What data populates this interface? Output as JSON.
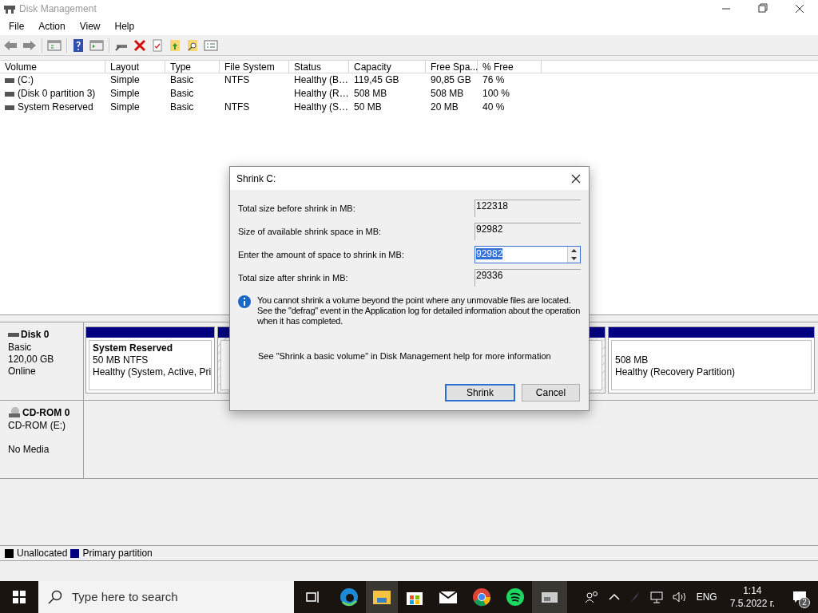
{
  "window": {
    "title": "Disk Management"
  },
  "menu": [
    "File",
    "Action",
    "View",
    "Help"
  ],
  "table": {
    "columns": [
      "Volume",
      "Layout",
      "Type",
      "File System",
      "Status",
      "Capacity",
      "Free Spa...",
      "% Free"
    ],
    "rows": [
      {
        "cells": [
          "(C:)",
          "Simple",
          "Basic",
          "NTFS",
          "Healthy (B…",
          "119,45 GB",
          "90,85 GB",
          "76 %"
        ]
      },
      {
        "cells": [
          "(Disk 0 partition 3)",
          "Simple",
          "Basic",
          "",
          "Healthy (R…",
          "508 MB",
          "508 MB",
          "100 %"
        ]
      },
      {
        "cells": [
          "System Reserved",
          "Simple",
          "Basic",
          "NTFS",
          "Healthy (S…",
          "50 MB",
          "20 MB",
          "40 %"
        ]
      }
    ]
  },
  "disks": [
    {
      "kind": "disk",
      "name": "Disk 0",
      "lines": [
        "Basic",
        "120,00 GB",
        "Online"
      ],
      "partitions": [
        {
          "selected": false,
          "title": "System Reserved",
          "lines": [
            "50 MB NTFS",
            "Healthy (System, Active, Pri"
          ]
        },
        {
          "selected": true
        },
        {
          "selected": false,
          "lines": [
            "508 MB",
            "Healthy (Recovery Partition)"
          ]
        }
      ]
    },
    {
      "kind": "cdrom",
      "name": "CD-ROM 0",
      "lines": [
        "CD-ROM (E:)",
        "No Media"
      ]
    }
  ],
  "legend": [
    {
      "label": "Unallocated",
      "color": "#000000"
    },
    {
      "label": "Primary partition",
      "color": "#000080"
    }
  ],
  "dialog": {
    "title": "Shrink C:",
    "fields": [
      {
        "kind": "readonly",
        "label": "Total size before shrink in MB:",
        "value": "122318"
      },
      {
        "kind": "readonly",
        "label": "Size of available shrink space in MB:",
        "value": "92982"
      },
      {
        "kind": "spin",
        "label": "Enter the amount of space to shrink in MB:",
        "value": "92982",
        "selected": true
      },
      {
        "kind": "readonly",
        "label": "Total size after shrink in MB:",
        "value": "29336"
      }
    ],
    "info": "You cannot shrink a volume beyond the point where any unmovable files are located. See the \"defrag\" event in the Application log for detailed information about the operation when it has completed.",
    "help": "See \"Shrink a basic volume\" in Disk Management help for more information",
    "buttons": [
      {
        "label": "Shrink",
        "default": true
      },
      {
        "label": "Cancel",
        "default": false
      }
    ]
  },
  "taskbar": {
    "search_placeholder": "Type here to search",
    "language": "ENG",
    "time": "1:14",
    "date": "7.5.2022 г.",
    "notifications": "2"
  }
}
